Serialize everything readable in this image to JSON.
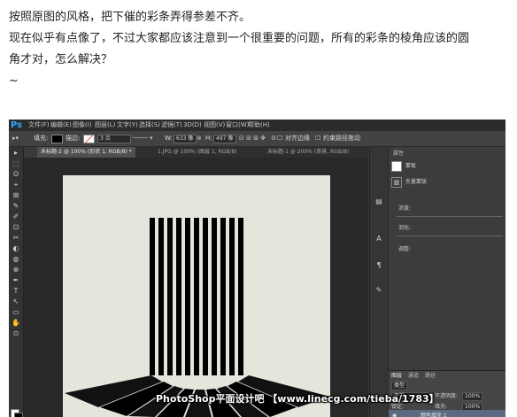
{
  "post": {
    "line1": "按照原图的风格，把下催的彩条弄得参差不齐。",
    "line2": "现在似乎有点像了，不过大家都应该注意到一个很重要的问题，所有的彩条的棱角应该的圆",
    "line3": "角才对，怎么解决？",
    "line4": "~"
  },
  "ps": {
    "logo": "Ps",
    "menu": [
      "文件(F)",
      "编辑(E)",
      "图像(I)",
      "图层(L)",
      "文字(Y)",
      "选择(S)",
      "滤镜(T)",
      "3D(D)",
      "视图(V)",
      "窗口(W)",
      "帮助(H)"
    ],
    "options": {
      "fill_label": "填充:",
      "stroke_label": "描边:",
      "stroke_width": "3 点",
      "w_label": "W:",
      "w_value": "633 像",
      "h_label": "H:",
      "h_value": "497 像",
      "align_edges": "对齐边缘",
      "constrain_path": "约束路径拖动"
    },
    "tabs": [
      "未标题-2 @ 100% (形状 1, RGB/8) *",
      "1.JPG @ 100% (图层 1, RGB/8)",
      "未标题-1 @ 200% (背景, RGB/8)"
    ],
    "tools": [
      "▸",
      "⬚",
      "ʘ",
      "⌖",
      "⊞",
      "✎",
      "✐",
      "⊡",
      "✂",
      "◐",
      "◍",
      "⊕",
      "✒",
      "T",
      "↖",
      "▭",
      "✋",
      "⊙"
    ],
    "panels": {
      "properties_tab": "属性",
      "mask_label": "蒙板",
      "vector_mask_label": "矢量蒙版",
      "density_label": "浓度:",
      "feather_label": "羽化:",
      "refine_label": "调整:",
      "layers_tabs": [
        "图层",
        "通道",
        "路径"
      ],
      "kind_label": "类型",
      "blend_mode": "正常",
      "opacity_label": "不透明度:",
      "opacity_value": "100%",
      "lock_label": "锁定:",
      "fill_label": "填充:",
      "fill_value": "100%",
      "layer_name": "颜色填充 1"
    },
    "stripes_count": 11
  },
  "watermark": "PhotoShop平面设计吧 【www.linecg.com/tieba/1783】"
}
